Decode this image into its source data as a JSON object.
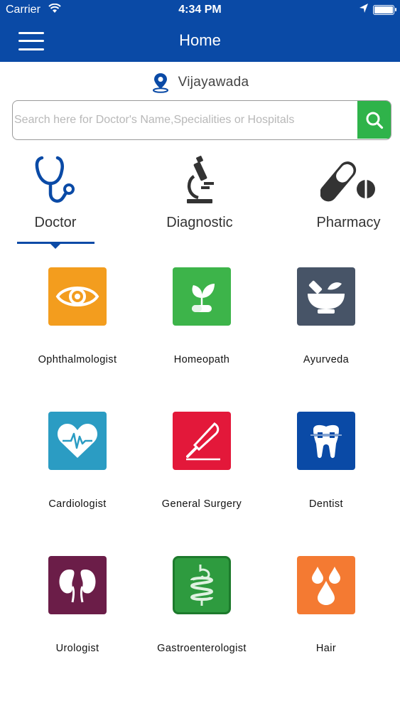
{
  "status_bar": {
    "carrier": "Carrier",
    "time": "4:34 PM"
  },
  "nav": {
    "title": "Home",
    "menu_icon": "hamburger-menu-icon"
  },
  "location": {
    "city": "Vijayawada",
    "icon": "map-pin-icon"
  },
  "search": {
    "placeholder": "Search here for Doctor's Name,Specialities or Hospitals",
    "value": "",
    "button_icon": "search-icon"
  },
  "categories": [
    {
      "label": "Doctor",
      "icon": "stethoscope-icon",
      "selected": true
    },
    {
      "label": "Diagnostic",
      "icon": "microscope-icon",
      "selected": false
    },
    {
      "label": "Pharmacy",
      "icon": "pills-icon",
      "selected": false
    }
  ],
  "specialties": [
    {
      "label": "Ophthalmologist",
      "icon": "eye-icon",
      "color": "#f39d1e"
    },
    {
      "label": "Homeopath",
      "icon": "herbal-capsule-icon",
      "color": "#3db44a"
    },
    {
      "label": "Ayurveda",
      "icon": "mortar-pestle-icon",
      "color": "#475467"
    },
    {
      "label": "Cardiologist",
      "icon": "heartbeat-icon",
      "color": "#2b9cc3"
    },
    {
      "label": "General Surgery",
      "icon": "scalpel-icon",
      "color": "#e3183a"
    },
    {
      "label": "Dentist",
      "icon": "tooth-braces-icon",
      "color": "#0a4aa6"
    },
    {
      "label": "Urologist",
      "icon": "kidneys-icon",
      "color": "#6b1d48"
    },
    {
      "label": "Gastroenterologist",
      "icon": "digestive-system-icon",
      "color": "#2e9b3f"
    },
    {
      "label": "Hair",
      "icon": "oil-drops-icon",
      "color": "#f47a32"
    }
  ],
  "colors": {
    "brand_blue": "#0a4aa6",
    "search_green": "#2fb34a"
  }
}
